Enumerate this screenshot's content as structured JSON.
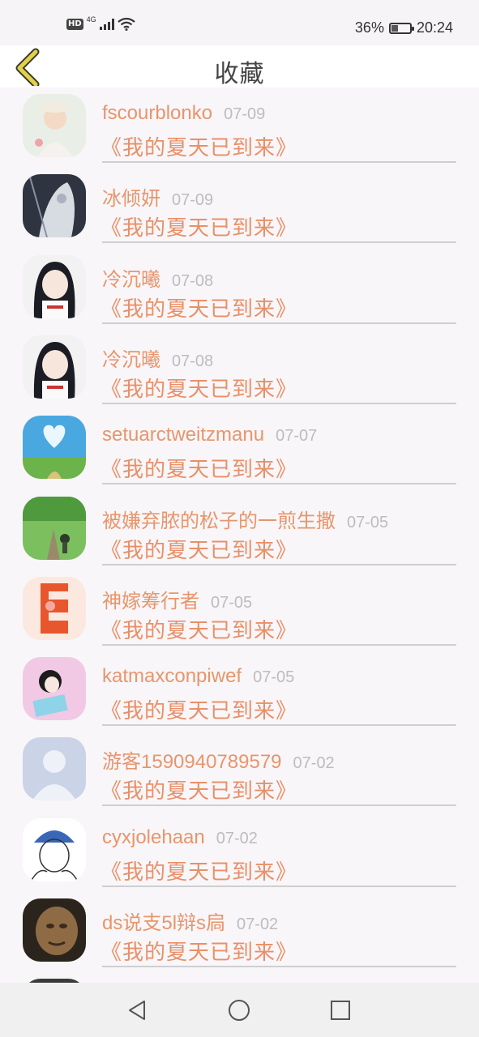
{
  "status_bar": {
    "hd_label": "HD",
    "network_label": "4G",
    "battery_percent": "36%",
    "battery_level": 0.36,
    "time": "20:24"
  },
  "header": {
    "title": "收藏",
    "back_icon": "chevron-left-icon",
    "accent_color": "#e2d24a"
  },
  "items": [
    {
      "name": "fscourblonko",
      "date": "07-09",
      "book": "《我的夏天已到来》"
    },
    {
      "name": "冰倾妍",
      "date": "07-09",
      "book": "《我的夏天已到来》"
    },
    {
      "name": "冷沉曦",
      "date": "07-08",
      "book": "《我的夏天已到来》"
    },
    {
      "name": "冷沉曦",
      "date": "07-08",
      "book": "《我的夏天已到来》"
    },
    {
      "name": "setuarctweitzmanu",
      "date": "07-07",
      "book": "《我的夏天已到来》"
    },
    {
      "name": "被嫌弃脓的松子的一煎生撒",
      "date": "07-05",
      "book": "《我的夏天已到来》"
    },
    {
      "name": "神嫁筹行者",
      "date": "07-05",
      "book": "《我的夏天已到来》"
    },
    {
      "name": "katmaxconpiwef",
      "date": "07-05",
      "book": "《我的夏天已到来》"
    },
    {
      "name": "游客1590940789579",
      "date": "07-02",
      "book": "《我的夏天已到来》"
    },
    {
      "name": "cyxjolehaan",
      "date": "07-02",
      "book": "《我的夏天已到来》"
    },
    {
      "name": "ds说支5l辩s扃",
      "date": "07-02",
      "book": "《我的夏天已到来》"
    }
  ],
  "colors": {
    "name_color": "#e8956c",
    "book_color": "#ea8f67",
    "date_color": "#bdbdbd"
  },
  "navbar": {
    "icons": [
      "back-triangle-icon",
      "home-circle-icon",
      "recents-square-icon"
    ]
  }
}
